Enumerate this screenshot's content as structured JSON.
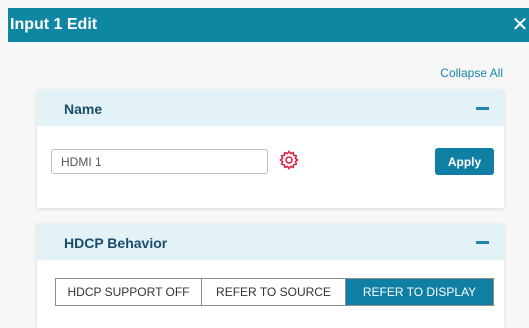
{
  "dialog": {
    "title": "Input 1 Edit",
    "close_icon": "close-icon",
    "collapse_all": "Collapse All"
  },
  "name_panel": {
    "title": "Name",
    "collapse_icon": "minus-icon",
    "input_value": "HDMI 1",
    "settings_icon": "gear-icon",
    "apply_label": "Apply"
  },
  "hdcp_panel": {
    "title": "HDCP Behavior",
    "collapse_icon": "minus-icon",
    "options": [
      "HDCP SUPPORT OFF",
      "REFER TO SOURCE",
      "REFER TO DISPLAY"
    ],
    "selected": "REFER TO DISPLAY"
  },
  "colors": {
    "header_bg": "#0f87a3",
    "accent": "#0f7fa3",
    "panel_header_bg": "#e2f2f6",
    "gear_icon": "#d7264b"
  }
}
